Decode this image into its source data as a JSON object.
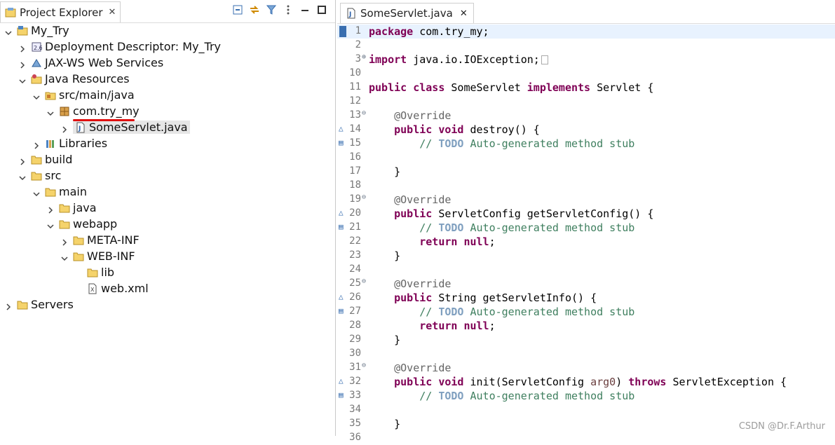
{
  "left_panel": {
    "tab_label": "Project Explorer",
    "tree": [
      {
        "label": "My_Try",
        "depth": 0,
        "expanded": true,
        "icon": "project-icon"
      },
      {
        "label": "Deployment Descriptor: My_Try",
        "depth": 1,
        "expanded": false,
        "icon": "deployment-descriptor-icon"
      },
      {
        "label": "JAX-WS Web Services",
        "depth": 1,
        "expanded": false,
        "icon": "web-services-icon"
      },
      {
        "label": "Java Resources",
        "depth": 1,
        "expanded": true,
        "icon": "java-resources-icon"
      },
      {
        "label": "src/main/java",
        "depth": 2,
        "expanded": true,
        "icon": "source-folder-icon"
      },
      {
        "label": "com.try_my",
        "depth": 3,
        "expanded": true,
        "icon": "package-icon"
      },
      {
        "label": "SomeServlet.java",
        "depth": 4,
        "expanded": false,
        "icon": "java-file-icon",
        "selected": true
      },
      {
        "label": "Libraries",
        "depth": 2,
        "expanded": false,
        "icon": "libraries-icon"
      },
      {
        "label": "build",
        "depth": 1,
        "expanded": false,
        "icon": "folder-icon"
      },
      {
        "label": "src",
        "depth": 1,
        "expanded": true,
        "icon": "folder-icon"
      },
      {
        "label": "main",
        "depth": 2,
        "expanded": true,
        "icon": "folder-icon"
      },
      {
        "label": "java",
        "depth": 3,
        "expanded": false,
        "icon": "folder-icon"
      },
      {
        "label": "webapp",
        "depth": 3,
        "expanded": true,
        "icon": "folder-icon"
      },
      {
        "label": "META-INF",
        "depth": 4,
        "expanded": false,
        "icon": "folder-icon"
      },
      {
        "label": "WEB-INF",
        "depth": 4,
        "expanded": true,
        "icon": "folder-icon"
      },
      {
        "label": "lib",
        "depth": 5,
        "expanded": null,
        "icon": "folder-icon"
      },
      {
        "label": "web.xml",
        "depth": 5,
        "expanded": null,
        "icon": "xml-file-icon"
      },
      {
        "label": "Servers",
        "depth": 0,
        "expanded": false,
        "icon": "folder-icon"
      }
    ]
  },
  "editor": {
    "tab_label": "SomeServlet.java",
    "lines": [
      {
        "n": "1",
        "tokens": [
          [
            "kw",
            "package"
          ],
          [
            "t",
            " com.try_my;"
          ]
        ],
        "hl": true
      },
      {
        "n": "2",
        "tokens": []
      },
      {
        "n": "3",
        "fold": "plus",
        "tokens": [
          [
            "kw",
            "import"
          ],
          [
            "t",
            " java.io.IOException;"
          ]
        ],
        "box": true
      },
      {
        "n": "10",
        "tokens": []
      },
      {
        "n": "11",
        "tokens": [
          [
            "kw",
            "public"
          ],
          [
            "t",
            " "
          ],
          [
            "kw",
            "class"
          ],
          [
            "t",
            " SomeServlet "
          ],
          [
            "kw",
            "implements"
          ],
          [
            "t",
            " Servlet {"
          ]
        ]
      },
      {
        "n": "12",
        "tokens": []
      },
      {
        "n": "13",
        "fold": "minus",
        "tokens": [
          [
            "t",
            "    "
          ],
          [
            "ann",
            "@Override"
          ]
        ]
      },
      {
        "n": "14",
        "mark": "override",
        "tokens": [
          [
            "t",
            "    "
          ],
          [
            "kw",
            "public"
          ],
          [
            "t",
            " "
          ],
          [
            "kw",
            "void"
          ],
          [
            "t",
            " destroy() {"
          ]
        ]
      },
      {
        "n": "15",
        "mark": "task",
        "tokens": [
          [
            "t",
            "        "
          ],
          [
            "cm",
            "// "
          ],
          [
            "todo",
            "TODO"
          ],
          [
            "cm",
            " Auto-generated method stub"
          ]
        ]
      },
      {
        "n": "16",
        "tokens": []
      },
      {
        "n": "17",
        "tokens": [
          [
            "t",
            "    }"
          ]
        ]
      },
      {
        "n": "18",
        "tokens": []
      },
      {
        "n": "19",
        "fold": "minus",
        "tokens": [
          [
            "t",
            "    "
          ],
          [
            "ann",
            "@Override"
          ]
        ]
      },
      {
        "n": "20",
        "mark": "override",
        "tokens": [
          [
            "t",
            "    "
          ],
          [
            "kw",
            "public"
          ],
          [
            "t",
            " ServletConfig getServletConfig() {"
          ]
        ]
      },
      {
        "n": "21",
        "mark": "task",
        "tokens": [
          [
            "t",
            "        "
          ],
          [
            "cm",
            "// "
          ],
          [
            "todo",
            "TODO"
          ],
          [
            "cm",
            " Auto-generated method stub"
          ]
        ]
      },
      {
        "n": "22",
        "tokens": [
          [
            "t",
            "        "
          ],
          [
            "kw",
            "return"
          ],
          [
            "t",
            " "
          ],
          [
            "kw",
            "null"
          ],
          [
            "t",
            ";"
          ]
        ]
      },
      {
        "n": "23",
        "tokens": [
          [
            "t",
            "    }"
          ]
        ]
      },
      {
        "n": "24",
        "tokens": []
      },
      {
        "n": "25",
        "fold": "minus",
        "tokens": [
          [
            "t",
            "    "
          ],
          [
            "ann",
            "@Override"
          ]
        ]
      },
      {
        "n": "26",
        "mark": "override",
        "tokens": [
          [
            "t",
            "    "
          ],
          [
            "kw",
            "public"
          ],
          [
            "t",
            " String getServletInfo() {"
          ]
        ]
      },
      {
        "n": "27",
        "mark": "task",
        "tokens": [
          [
            "t",
            "        "
          ],
          [
            "cm",
            "// "
          ],
          [
            "todo",
            "TODO"
          ],
          [
            "cm",
            " Auto-generated method stub"
          ]
        ]
      },
      {
        "n": "28",
        "tokens": [
          [
            "t",
            "        "
          ],
          [
            "kw",
            "return"
          ],
          [
            "t",
            " "
          ],
          [
            "kw",
            "null"
          ],
          [
            "t",
            ";"
          ]
        ]
      },
      {
        "n": "29",
        "tokens": [
          [
            "t",
            "    }"
          ]
        ]
      },
      {
        "n": "30",
        "tokens": []
      },
      {
        "n": "31",
        "fold": "minus",
        "tokens": [
          [
            "t",
            "    "
          ],
          [
            "ann",
            "@Override"
          ]
        ]
      },
      {
        "n": "32",
        "mark": "override",
        "tokens": [
          [
            "t",
            "    "
          ],
          [
            "kw",
            "public"
          ],
          [
            "t",
            " "
          ],
          [
            "kw",
            "void"
          ],
          [
            "t",
            " init(ServletConfig "
          ],
          [
            "param",
            "arg0"
          ],
          [
            "t",
            ") "
          ],
          [
            "kw",
            "throws"
          ],
          [
            "t",
            " ServletException {"
          ]
        ]
      },
      {
        "n": "33",
        "mark": "task",
        "tokens": [
          [
            "t",
            "        "
          ],
          [
            "cm",
            "// "
          ],
          [
            "todo",
            "TODO"
          ],
          [
            "cm",
            " Auto-generated method stub"
          ]
        ]
      },
      {
        "n": "34",
        "tokens": []
      },
      {
        "n": "35",
        "tokens": [
          [
            "t",
            "    }"
          ]
        ]
      },
      {
        "n": "36",
        "tokens": []
      }
    ]
  },
  "watermark": "CSDN @Dr.F.Arthur"
}
